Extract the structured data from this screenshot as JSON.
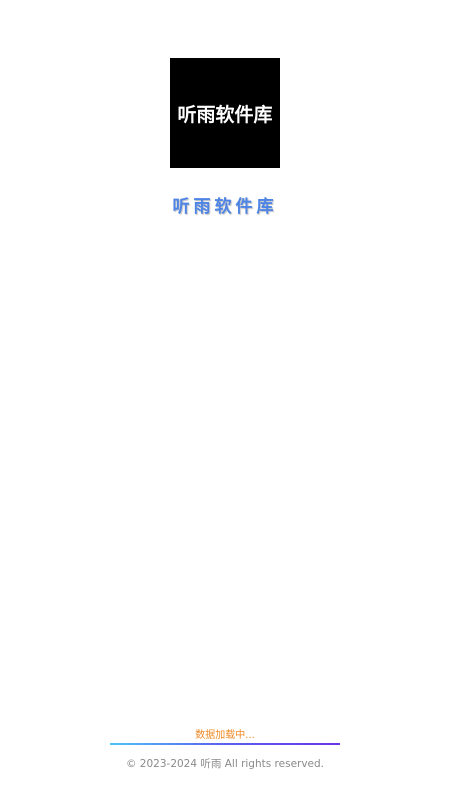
{
  "logo": {
    "text": "听雨软件库",
    "background": "#000000",
    "text_color": "#ffffff"
  },
  "app_name": "听雨软件库",
  "app_name_color": "#4d84e6",
  "loading": {
    "status_text": "数据加载中...",
    "status_color": "#f08a26",
    "progress": 1.0
  },
  "footer": {
    "copyright": "© 2023-2024 听雨  All rights reserved."
  }
}
